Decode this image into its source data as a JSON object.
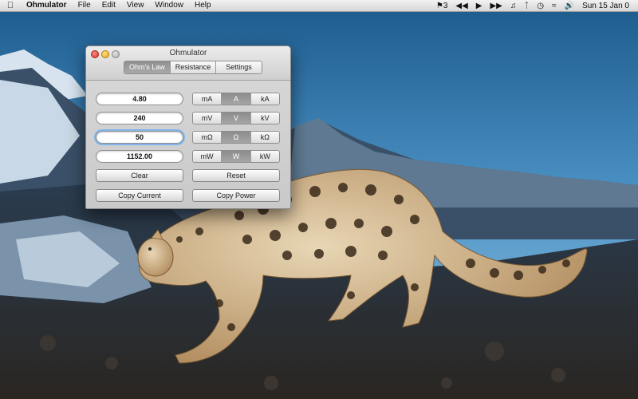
{
  "menubar": {
    "app_name": "Ohmulator",
    "menus": [
      "File",
      "Edit",
      "View",
      "Window",
      "Help"
    ],
    "status": {
      "notifications_count": "3",
      "datetime": "Sun 15 Jan 0"
    }
  },
  "window": {
    "title": "Ohmulator",
    "tabs": [
      {
        "label": "Ohm's Law",
        "active": true
      },
      {
        "label": "Resistance",
        "active": false
      },
      {
        "label": "Settings",
        "active": false
      }
    ]
  },
  "rows": [
    {
      "value": "4.80",
      "units": [
        "mA",
        "A",
        "kA"
      ],
      "selected": 1
    },
    {
      "value": "240",
      "units": [
        "mV",
        "V",
        "kV"
      ],
      "selected": 1
    },
    {
      "value": "50",
      "units": [
        "mΩ",
        "Ω",
        "kΩ"
      ],
      "selected": 1
    },
    {
      "value": "1152.00",
      "units": [
        "mW",
        "W",
        "kW"
      ],
      "selected": 1
    }
  ],
  "buttons": {
    "clear": "Clear",
    "reset": "Reset",
    "copy_current": "Copy Current",
    "copy_power": "Copy Power"
  },
  "icons": [
    "apple-icon",
    "notification-icon",
    "rewind-icon",
    "play-icon",
    "fast-forward-icon",
    "itunes-icon",
    "bluetooth-icon",
    "time-machine-icon",
    "wifi-icon",
    "volume-icon"
  ]
}
